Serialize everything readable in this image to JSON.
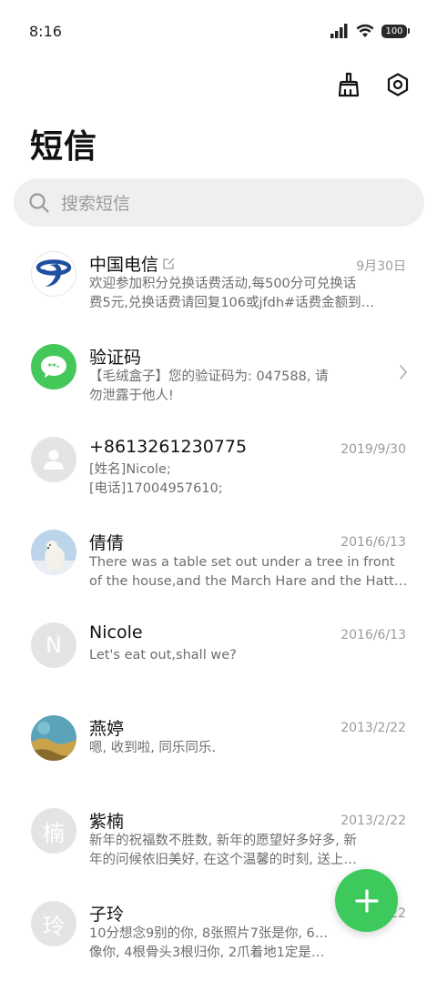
{
  "status_bar": {
    "time": "8:16",
    "battery": "100"
  },
  "header": {
    "title": "短信",
    "actions": [
      {
        "icon": "broom-icon"
      },
      {
        "icon": "settings-hexagon-icon"
      }
    ]
  },
  "search": {
    "placeholder": "搜索短信"
  },
  "conversations": [
    {
      "name": "中国电信",
      "date": "9月30日",
      "preview": [
        "欢迎参加积分兑换话费活动,每500分可兑换话",
        "费5元,兑换话费请回复106或jfdh#话费金额到…"
      ],
      "avatar": "china-telecom-logo"
    },
    {
      "name": "验证码",
      "date": "",
      "preview": [
        "【毛绒盒子】您的验证码为: 047588, 请",
        "勿泄露于他人!"
      ],
      "avatar": "sms-code-icon"
    },
    {
      "name": "+8613261230775",
      "date": "2019/9/30",
      "preview": [
        "[姓名]Nicole;",
        "[电话]17004957610;"
      ],
      "avatar": "person-icon"
    },
    {
      "name": "倩倩",
      "date": "2016/6/13",
      "preview": [
        "There was a table set out under a tree in front",
        "of the house,and the March Hare and the Hatter…"
      ],
      "avatar": "polar-bear-photo"
    },
    {
      "name": "Nicole",
      "date": "2016/6/13",
      "preview": [
        "Let's eat out,shall we?"
      ],
      "avatar_letter": "N"
    },
    {
      "name": "燕婷",
      "date": "2013/2/22",
      "preview": [
        "嗯, 收到啦, 同乐同乐."
      ],
      "avatar": "landscape-photo"
    },
    {
      "name": "紫楠",
      "date": "2013/2/22",
      "preview": [
        "新年的祝福数不胜数, 新年的愿望好多好多, 新",
        "年的问候依旧美好, 在这个温馨的时刻, 送上…"
      ],
      "avatar_letter": "楠"
    },
    {
      "name": "子玲",
      "date": "2013/2/22",
      "preview": [
        "10分想念9别的你, 8张照片7张是你, 6…",
        "像你, 4根骨头3根归你, 2爪着地1定是…"
      ],
      "avatar_letter": "玲"
    }
  ],
  "colors": {
    "accent": "#3ec95c",
    "telecom_blue": "#1e4fa0"
  }
}
